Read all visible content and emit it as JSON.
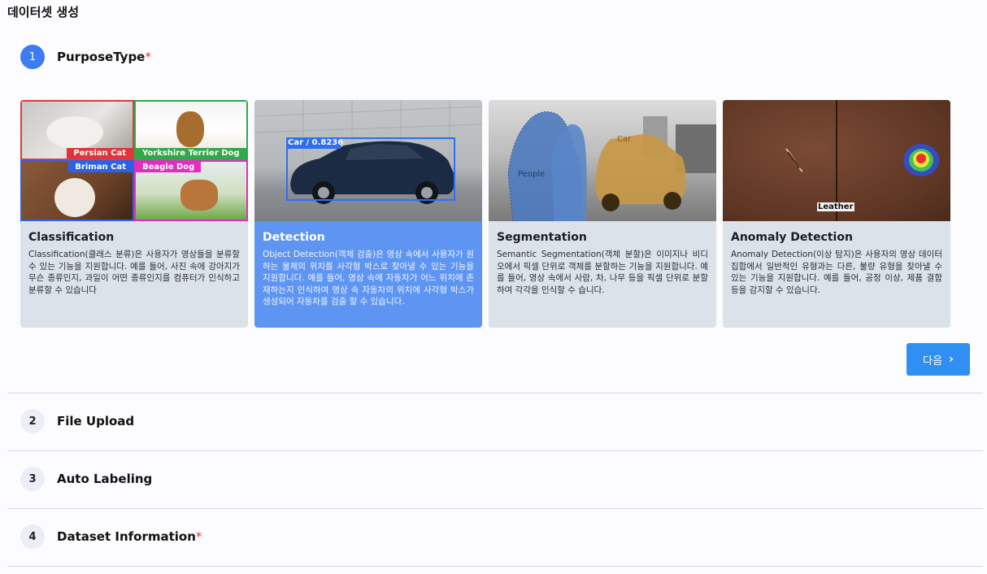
{
  "page_title": "데이터셋 생성",
  "steps": [
    {
      "num": "1",
      "label": "PurposeType",
      "required": "*"
    },
    {
      "num": "2",
      "label": "File Upload"
    },
    {
      "num": "3",
      "label": "Auto Labeling"
    },
    {
      "num": "4",
      "label": "Dataset Information",
      "required": "*"
    }
  ],
  "cards": [
    {
      "title": "Classification",
      "desc": "Classification(클래스 분류)은 사용자가 영상들을 분류할 수 있는 기능을 지원합니다. 예를 들어, 사진 속에 강아지가 무슨 종류인지, 과일이 어떤 종류인지를 컴퓨터가 인식하고 분류할 수 있습니다",
      "image_labels": [
        "Persian Cat",
        "Yorkshire Terrier Dog",
        "Briman Cat",
        "Beagle Dog"
      ]
    },
    {
      "title": "Detection",
      "desc": "Object Detection(객체 검출)은 영상 속에서 사용자가 원하는 물체의 위치를 사각형 박스로 찾아낼 수 있는 기능을 지원합니다. 예를 들어, 영상 속에 자동차가 어느 위치에 존재하는지 인식하여 영상 속 자동차의 위치에 사각형 박스가 생성되어 자동차를 검출 할 수 있습니다.",
      "image_labels": [
        "Car / 0.8236"
      ],
      "selected": true
    },
    {
      "title": "Segmentation",
      "desc": "Semantic Segmentation(객체 분할)은 이미지나 비디오에서 픽셀 단위로 객체를 분할하는 기능을 지원합니다. 예를 들어, 영상 속에서 사람, 차, 나무 등을 픽셀 단위로 분할하여 각각을 인식할 수 습니다.",
      "image_labels": [
        "People",
        "Car"
      ]
    },
    {
      "title": "Anomaly Detection",
      "desc": "Anomaly Detection(이상 탐지)은 사용자의 영상 데이터 집합에서 일반적인 유형과는 다른, 불량 유형을 찾아낼 수 있는 기능을 지원합니다. 예를 들어, 공정 이상, 제품 결함 등을 감지할 수 있습니다.",
      "image_labels": [
        "Leather"
      ]
    }
  ],
  "next_button": {
    "label": "다음",
    "icon": "chevron-right-icon"
  },
  "colors": {
    "accent": "#3d7cf0",
    "selected_card": "#5f95f2",
    "card": "#dbe2ea",
    "button": "#2f8ff2",
    "required": "#e0343a"
  }
}
